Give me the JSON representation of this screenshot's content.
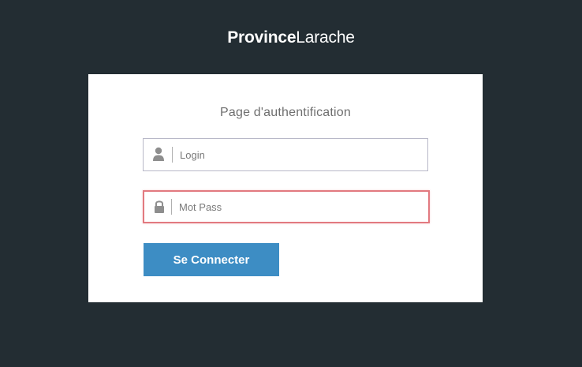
{
  "brand": {
    "bold": "Province",
    "light": "Larache"
  },
  "login_card": {
    "title": "Page d'authentification",
    "login_field": {
      "placeholder": "Login",
      "value": "",
      "icon": "user-icon"
    },
    "password_field": {
      "placeholder": "Mot Pass",
      "value": "",
      "icon": "lock-icon",
      "state": "invalid"
    },
    "submit_label": "Se Connecter"
  },
  "colors": {
    "background": "#232d33",
    "card": "#ffffff",
    "button": "#3d8dc4",
    "error_border": "#e27a80"
  }
}
